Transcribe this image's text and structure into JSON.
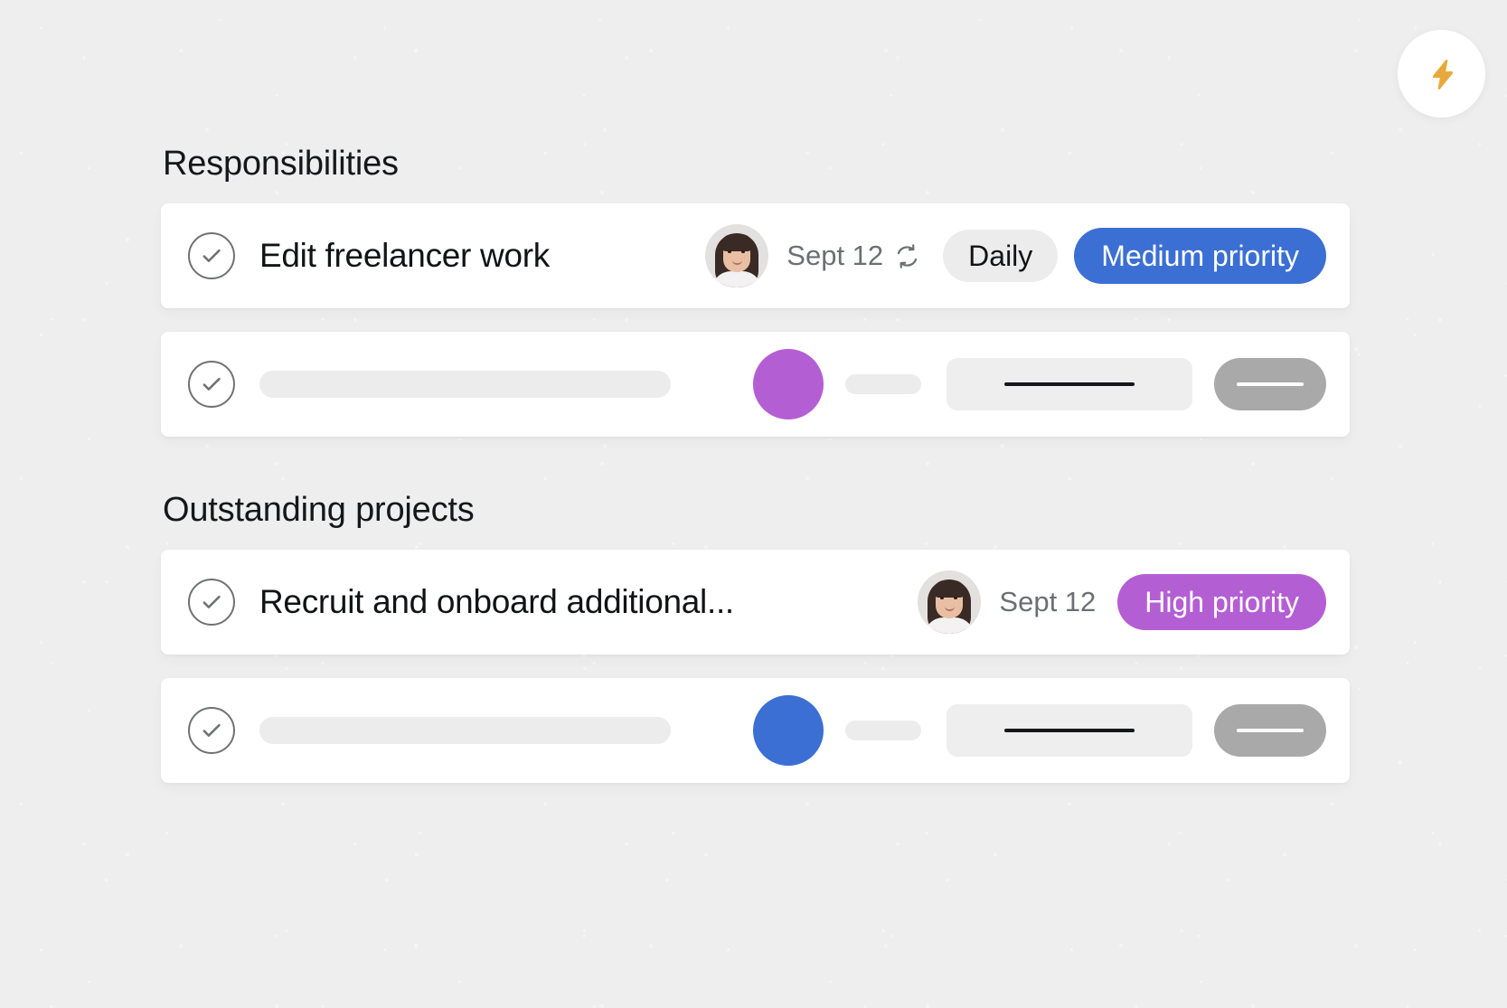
{
  "floating_action": {
    "icon": "lightning-bolt-icon",
    "icon_color": "#e8a93c",
    "background": "#ffffff"
  },
  "colors": {
    "canvas": "#eeeeee",
    "card": "#ffffff",
    "medium_priority": "#3b6fd4",
    "high_priority": "#b45ed4",
    "skeleton_dot_purple": "#b45ed4",
    "skeleton_dot_blue": "#3b6fd4",
    "skeleton_light": "#ececec",
    "skeleton_gray": "#a9a9a9",
    "text_primary": "#111315",
    "text_muted": "#6c6f73"
  },
  "sections": [
    {
      "title": "Responsibilities",
      "rows": [
        {
          "kind": "task",
          "checkbox_icon": "check-circle-icon",
          "title": "Edit freelancer work",
          "avatar_alt": "assignee-avatar",
          "due_date": "Sept 12",
          "repeat_icon": "repeat-icon",
          "recurrence_label": "Daily",
          "priority_label": "Medium priority",
          "priority_color": "#3b6fd4"
        },
        {
          "kind": "skeleton",
          "checkbox_icon": "check-circle-icon",
          "dot_color": "#b45ed4"
        }
      ]
    },
    {
      "title": "Outstanding projects",
      "rows": [
        {
          "kind": "task",
          "checkbox_icon": "check-circle-icon",
          "title": "Recruit and onboard additional...",
          "avatar_alt": "assignee-avatar",
          "due_date": "Sept 12",
          "repeat_icon": null,
          "recurrence_label": null,
          "priority_label": "High priority",
          "priority_color": "#b45ed4"
        },
        {
          "kind": "skeleton",
          "checkbox_icon": "check-circle-icon",
          "dot_color": "#3b6fd4"
        }
      ]
    }
  ]
}
